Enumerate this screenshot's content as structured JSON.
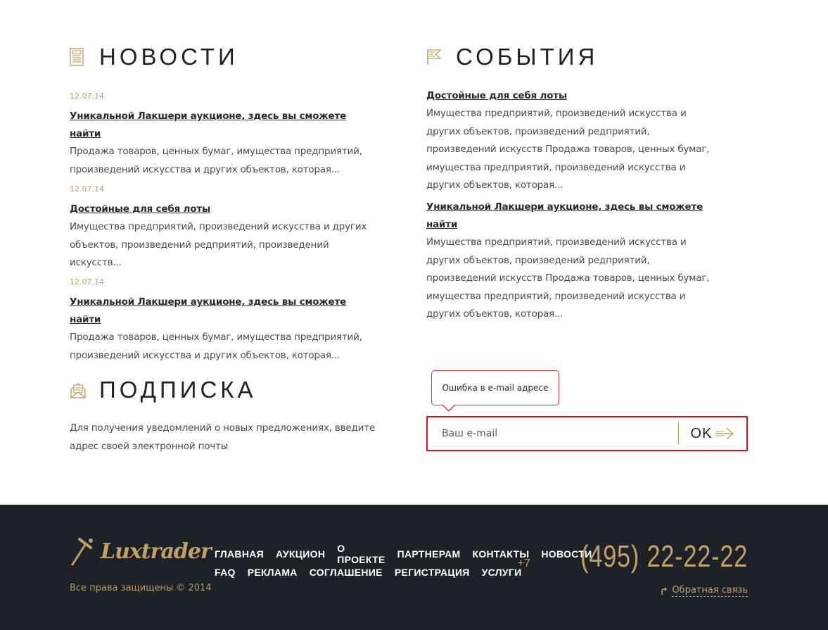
{
  "news": {
    "title": "НОВОСТИ",
    "icon": "newspaper-icon",
    "items": [
      {
        "date": "12.07.14",
        "title": "Уникальной Лакшери аукционе, здесь вы сможете найти",
        "text": "Продажа товаров, ценных бумаг, имущества предприятий, произведений искусства и других объектов, которая..."
      },
      {
        "date": "12.07.14",
        "title": "Достойные для себя лоты",
        "text": "Имущества предприятий, произведений искусства и других объектов, произведений редприятий, произведений искусств..."
      },
      {
        "date": "12.07.14",
        "title": "Уникальной Лакшери аукционе, здесь вы сможете найти",
        "text": "Продажа товаров, ценных бумаг, имущества предприятий, произведений искусства и других объектов, которая..."
      }
    ]
  },
  "events": {
    "title": "СОБЫТИЯ",
    "icon": "flag-icon",
    "items": [
      {
        "title": "Достойные для себя лоты",
        "text": "Имущества предприятий, произведений искусства и других объектов, произведений редприятий, произведений искусств Продажа товаров, ценных бумаг, имущества предприятий, произведений искусства и других объектов, которая..."
      },
      {
        "title": "Уникальной Лакшери аукционе, здесь вы сможете найти",
        "text": "Имущества предприятий, произведений искусства и других объектов, произведений редприятий, произведений искусств Продажа товаров, ценных бумаг, имущества предприятий, произведений искусства и других объектов, которая..."
      }
    ]
  },
  "subscribe": {
    "title": "ПОДПИСКА",
    "icon": "mail-icon",
    "text": "Для получения уведомлений о новых предложениях, введите адрес своей электронной почты",
    "error": "Ошибка в e-mail адресе",
    "placeholder": "Ваш e-mail",
    "button": "OK"
  },
  "footer": {
    "logo_text": "Luxtrader",
    "copyright": "Все права защищены © 2014",
    "nav_row1": [
      "ГЛАВНАЯ",
      "АУКЦИОН",
      "О ПРОЕКТЕ",
      "ПАРТНЕРАМ",
      "КОНТАКТЫ",
      "НОВОСТИ"
    ],
    "nav_row2": [
      "FAQ",
      "РЕКЛАМА",
      "СОГЛАШЕНИЕ",
      "РЕГИСТРАЦИЯ",
      "УСЛУГИ"
    ],
    "phone_code": "+7",
    "phone_number": "(495) 22-22-22",
    "feedback": "Обратная связь"
  },
  "colors": {
    "accent": "#c2a065",
    "dark": "#1d2228",
    "error": "#e30e1b"
  }
}
